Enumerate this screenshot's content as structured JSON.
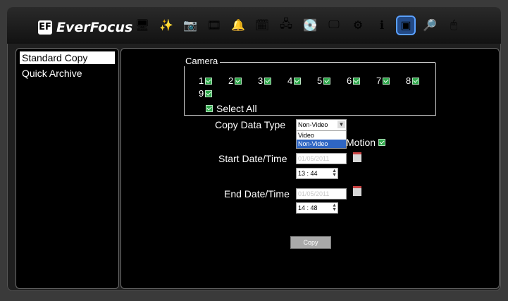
{
  "app": {
    "brand": "EverFocus"
  },
  "toolbar": [
    {
      "icon": "monitor-icon",
      "glyph": "🖥"
    },
    {
      "icon": "wand-icon",
      "glyph": "✨"
    },
    {
      "icon": "camera-icon",
      "glyph": "📷"
    },
    {
      "icon": "film-reel-icon",
      "glyph": "🎞"
    },
    {
      "icon": "bell-icon",
      "glyph": "🔔"
    },
    {
      "icon": "schedule-icon",
      "glyph": "🗓"
    },
    {
      "icon": "network-icon",
      "glyph": "🖧"
    },
    {
      "icon": "disk-icon",
      "glyph": "💽"
    },
    {
      "icon": "display-icon",
      "glyph": "🖵"
    },
    {
      "icon": "settings-gears-icon",
      "glyph": "⚙"
    },
    {
      "icon": "info-icon",
      "glyph": "ℹ"
    },
    {
      "icon": "copy-backup-icon",
      "glyph": "▣",
      "active": true
    },
    {
      "icon": "search-log-icon",
      "glyph": "🔎"
    },
    {
      "icon": "mouse-icon",
      "glyph": "🖱"
    }
  ],
  "sidebar": {
    "items": [
      {
        "label": "Standard Copy",
        "selected": true
      },
      {
        "label": "Quick Archive",
        "selected": false
      }
    ]
  },
  "camera": {
    "legend": "Camera",
    "channels": [
      "1",
      "2",
      "3",
      "4",
      "5",
      "6",
      "7",
      "8",
      "9"
    ],
    "select_all_label": "Select All"
  },
  "copy_data_type": {
    "label": "Copy Data Type",
    "value": "Non-Video",
    "options": [
      "Video",
      "Non-Video"
    ]
  },
  "motion": {
    "label": "Motion"
  },
  "start": {
    "label": "Start Date/Time",
    "date": "01/05/2011",
    "time": "13 : 44"
  },
  "end": {
    "label": "End Date/Time",
    "date": "01/05/2011",
    "time": "14 : 48"
  },
  "copy_button": "Copy"
}
